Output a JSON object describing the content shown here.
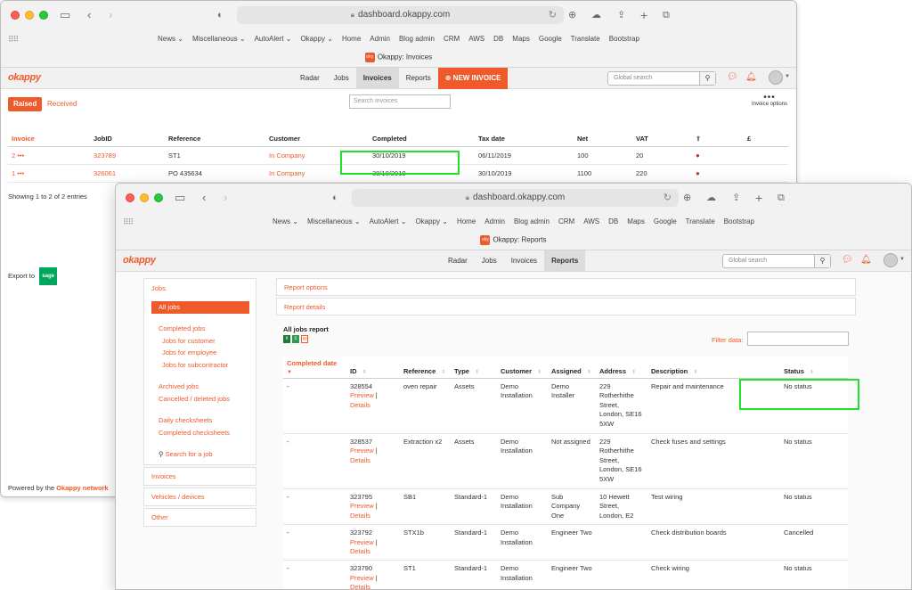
{
  "invoices_window": {
    "url": "dashboard.okappy.com",
    "tab_title": "Okappy: Invoices",
    "bookmarks": [
      "News ⌄",
      "Miscellaneous ⌄",
      "AutoAlert ⌄",
      "Okappy ⌄",
      "Home",
      "Admin",
      "Blog admin",
      "CRM",
      "AWS",
      "DB",
      "Maps",
      "Google",
      "Translate",
      "Bootstrap"
    ],
    "logo": "okappy",
    "nav": [
      "Radar",
      "Jobs",
      "Invoices",
      "Reports"
    ],
    "new_invoice": "⊕ NEW INVOICE",
    "global_search_placeholder": "Global search",
    "tab_raised": "Raised",
    "tab_received": "Received",
    "search_invoices_placeholder": "Search invoices",
    "invoice_options": "Invoice options",
    "columns": [
      "Invoice",
      "JobID",
      "Reference",
      "Customer",
      "Completed",
      "Tax date",
      "Net",
      "VAT",
      "⇪",
      "£"
    ],
    "rows": [
      {
        "invoice": "2 •••",
        "jobid": "323789",
        "reference": "ST1",
        "customer": "In Company",
        "completed": "30/10/2019",
        "tax_date": "06/11/2019",
        "net": "100",
        "vat": "20"
      },
      {
        "invoice": "1 •••",
        "jobid": "326061",
        "reference": "PO 435634",
        "customer": "In Company",
        "completed": "30/10/2019",
        "tax_date": "30/10/2019",
        "net": "1100",
        "vat": "220"
      }
    ],
    "showing": "Showing 1 to 2 of 2 entries",
    "export_to": "Export to",
    "sage": "sage",
    "powered_prefix": "Powered by the ",
    "powered_link": "Okappy network"
  },
  "reports_window": {
    "url": "dashboard.okappy.com",
    "tab_title": "Okappy: Reports",
    "bookmarks": [
      "News ⌄",
      "Miscellaneous ⌄",
      "AutoAlert ⌄",
      "Okappy ⌄",
      "Home",
      "Admin",
      "Blog admin",
      "CRM",
      "AWS",
      "DB",
      "Maps",
      "Google",
      "Translate",
      "Bootstrap"
    ],
    "logo": "okappy",
    "nav": [
      "Radar",
      "Jobs",
      "Invoices",
      "Reports"
    ],
    "global_search_placeholder": "Global search",
    "sidebar": {
      "jobs": "Jobs",
      "all_jobs": "All jobs",
      "links": [
        "Completed jobs",
        "Jobs for customer",
        "Jobs for employee",
        "Jobs for subcontractor",
        "Archived jobs",
        "Cancelled / deleted jobs",
        "Daily checksheets",
        "Completed checksheets"
      ],
      "search_job": "Search for a job",
      "invoices": "Invoices",
      "vehicles": "Vehicles / devices",
      "other": "Other"
    },
    "report_options": "Report options",
    "report_details": "Report details",
    "report_title": "All jobs report",
    "filter_label": "Filter data:",
    "columns": [
      "Completed date",
      "ID",
      "Reference",
      "Type",
      "Customer",
      "Assigned",
      "Address",
      "Description",
      "Status"
    ],
    "rows": [
      {
        "completed": "-",
        "id": "328554",
        "reference": "oven repair",
        "type": "Assets",
        "customer": "Demo Installation",
        "assigned": "Demo Installer",
        "address": "229 Rotherhithe Street, London, SE16 5XW",
        "description": "Repair and maintenance",
        "status": "No status"
      },
      {
        "completed": "-",
        "id": "328537",
        "reference": "Extraction x2",
        "type": "Assets",
        "customer": "Demo Installation",
        "assigned": "Not assigned",
        "address": "229 Rotherhithe Street, London, SE16 5XW",
        "description": "Check fuses and settings",
        "status": "No status"
      },
      {
        "completed": "-",
        "id": "323795",
        "reference": "SB1",
        "type": "Standard-1",
        "customer": "Demo Installation",
        "assigned": "Sub Company One",
        "address": "10 Hewett Street, London, E2",
        "description": "Test wiring",
        "status": "No status"
      },
      {
        "completed": "-",
        "id": "323792",
        "reference": "STX1b",
        "type": "Standard-1",
        "customer": "Demo Installation",
        "assigned": "Engineer Two",
        "address": "",
        "description": "Check distribution boards",
        "status": "Cancelled"
      },
      {
        "completed": "-",
        "id": "323790",
        "reference": "ST1",
        "type": "Standard-1",
        "customer": "Demo Installation",
        "assigned": "Engineer Two",
        "address": "",
        "description": "Check wiring",
        "status": "No status"
      }
    ],
    "preview": "Preview",
    "details": "Details"
  },
  "colors": {
    "accent": "#ef5a2a",
    "highlight": "#22e02b"
  }
}
